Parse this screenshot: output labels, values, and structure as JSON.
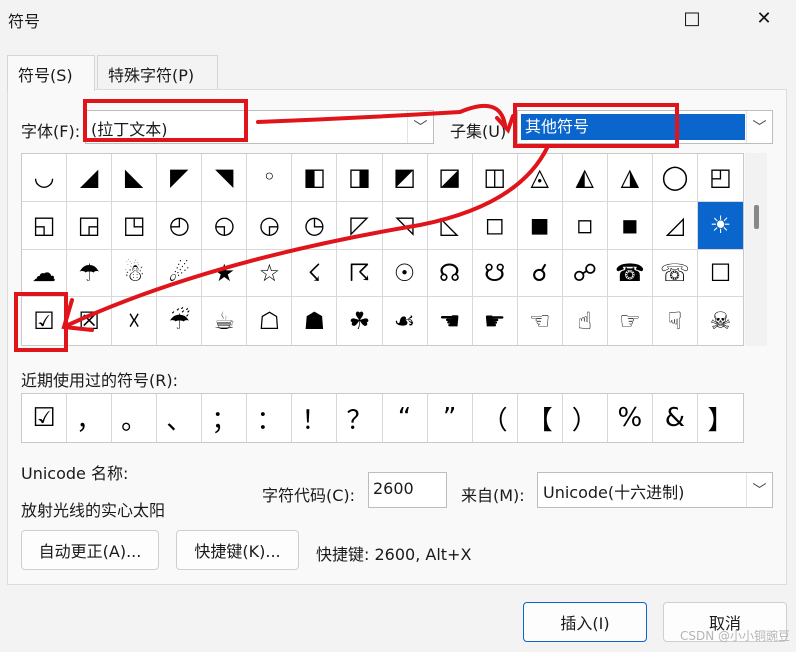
{
  "window": {
    "title": "符号",
    "maximize_icon": "□",
    "close_icon": "✕"
  },
  "tabs": [
    {
      "label": "符号(S)"
    },
    {
      "label": "特殊字符(P)"
    }
  ],
  "font": {
    "label": "字体(F):",
    "value": "(拉丁文本)"
  },
  "subset": {
    "label": "子集(U)",
    "value": "其他符号"
  },
  "symbols": [
    [
      "◡",
      "◢",
      "◣",
      "◤",
      "◥",
      "◦",
      "◧",
      "◨",
      "◩",
      "◪",
      "◫",
      "◬",
      "◭",
      "◮",
      "◯",
      "◰"
    ],
    [
      "◱",
      "◲",
      "◳",
      "◴",
      "◵",
      "◶",
      "◷",
      "◸",
      "◹",
      "◺",
      "◻",
      "◼",
      "◽",
      "◾",
      "◿",
      "☀"
    ],
    [
      "☁",
      "☂",
      "☃",
      "☄",
      "★",
      "☆",
      "☇",
      "☈",
      "☉",
      "☊",
      "☋",
      "☌",
      "☍",
      "☎",
      "☏",
      "☐"
    ],
    [
      "☑",
      "☒",
      "☓",
      "☔",
      "☕",
      "☖",
      "☗",
      "☘",
      "☙",
      "☚",
      "☛",
      "☜",
      "☝",
      "☞",
      "☟",
      "☠"
    ]
  ],
  "recent": {
    "label": "近期使用过的符号(R):",
    "items": [
      "☑",
      "，",
      "。",
      "、",
      "；",
      "：",
      "！",
      "？",
      "“",
      "”",
      "（",
      "【",
      "）",
      "%",
      "&",
      "】"
    ]
  },
  "unicode_name": {
    "label": "Unicode 名称:",
    "value": "放射光线的实心太阳"
  },
  "char_code": {
    "label": "字符代码(C):",
    "value": "2600"
  },
  "from": {
    "label": "来自(M):",
    "value": "Unicode(十六进制)"
  },
  "buttons": {
    "autocorrect": "自动更正(A)...",
    "shortcut_key": "快捷键(K)...",
    "insert": "插入(I)",
    "cancel": "取消"
  },
  "shortcut_text": "快捷键: 2600, Alt+X",
  "watermark": "CSDN @小小铜豌豆",
  "colors": {
    "accent": "#0a66cc",
    "annotation": "#e0141b"
  }
}
